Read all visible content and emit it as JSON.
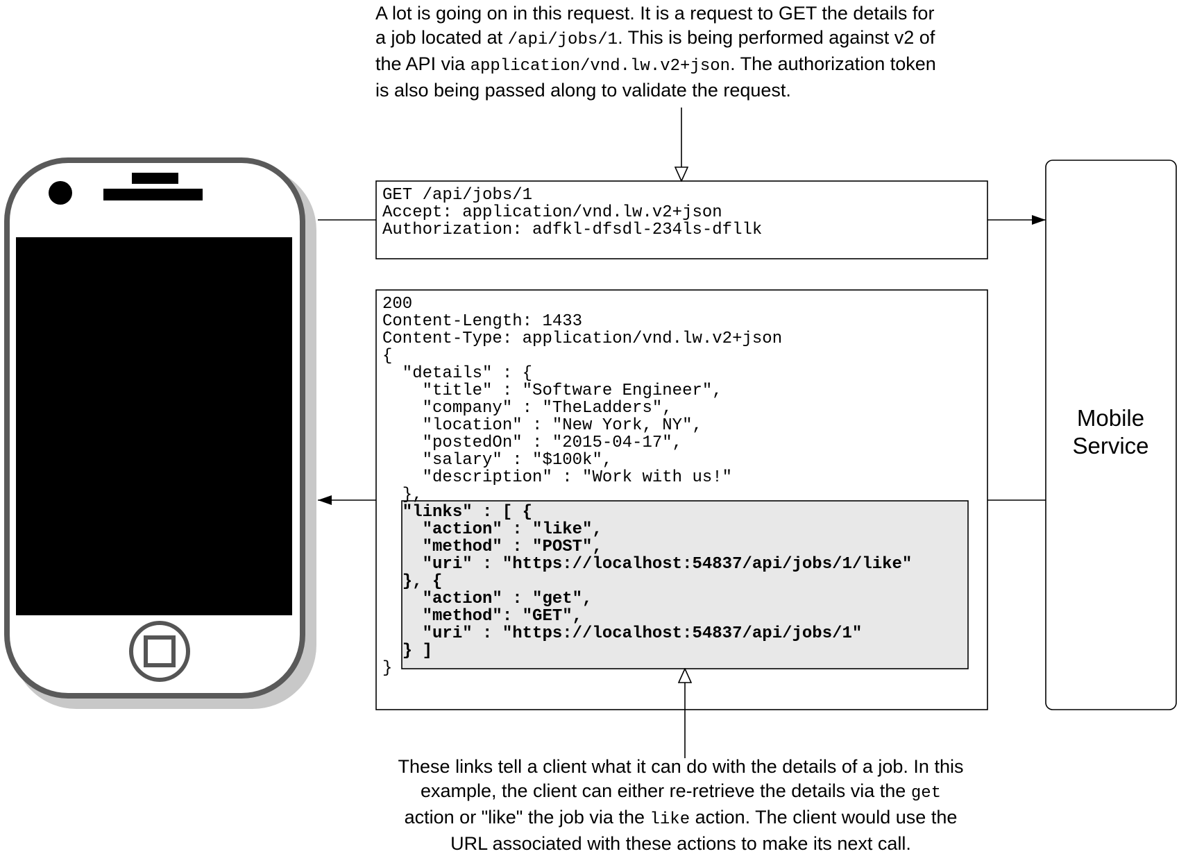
{
  "top_note": {
    "line1": "A lot is going on in this request. It is a request to GET the details for",
    "line2_pre": "a job located at ",
    "line2_code": "/api/jobs/1",
    "line2_post": ".  This is being performed against v2 of",
    "line3_pre": "the API via ",
    "line3_code": "application/vnd.lw.v2+json",
    "line3_post": ".  The authorization token",
    "line4": "is also being passed along to validate the request."
  },
  "request": {
    "line1": "GET /api/jobs/1",
    "line2": "Accept: application/vnd.lw.v2+json",
    "line3": "Authorization: adfkl-dfsdl-234ls-dfllk"
  },
  "response": {
    "status": "200",
    "content_length": "Content-Length: 1433",
    "content_type": "Content-Type: application/vnd.lw.v2+json",
    "open_brace": "{",
    "details_open": "  \"details\" : {",
    "title": "    \"title\" : \"Software Engineer\",",
    "company": "    \"company\" : \"TheLadders\",",
    "location": "    \"location\" : \"New York, NY\",",
    "posted_on": "    \"postedOn\" : \"2015-04-17\",",
    "salary": "    \"salary\" : \"$100k\",",
    "description": "    \"description\" : \"Work with us!\"",
    "details_close": "  },",
    "close_brace": "}"
  },
  "links": {
    "open": "  \"links\" : [ {",
    "action1": "    \"action\" : \"like\",",
    "method1": "    \"method\" : \"POST\",",
    "uri1": "    \"uri\" : \"https://localhost:54837/api/jobs/1/like\"",
    "separator": "  }, {",
    "action2": "    \"action\" : \"get\",",
    "method2": "    \"method\": \"GET\",",
    "uri2": "    \"uri\" : \"https://localhost:54837/api/jobs/1\"",
    "close": "  } ]"
  },
  "service": {
    "line1": "Mobile",
    "line2": "Service"
  },
  "bottom_note": {
    "line1": "These links tell a client what it can do with the details of a job. In this",
    "line2_pre": "example, the client can either re-retrieve the details via the ",
    "line2_code": "get",
    "line3_pre": "action or \"like\" the job via the ",
    "line3_code": "like",
    "line3_post": " action. The client would use the",
    "line4": "URL associated with these actions to make its next call."
  },
  "colors": {
    "stroke": "#000000",
    "links_highlight": "#e8e8e8",
    "phone_shadow": "#c8c8c8",
    "phone_screen": "#000000"
  }
}
